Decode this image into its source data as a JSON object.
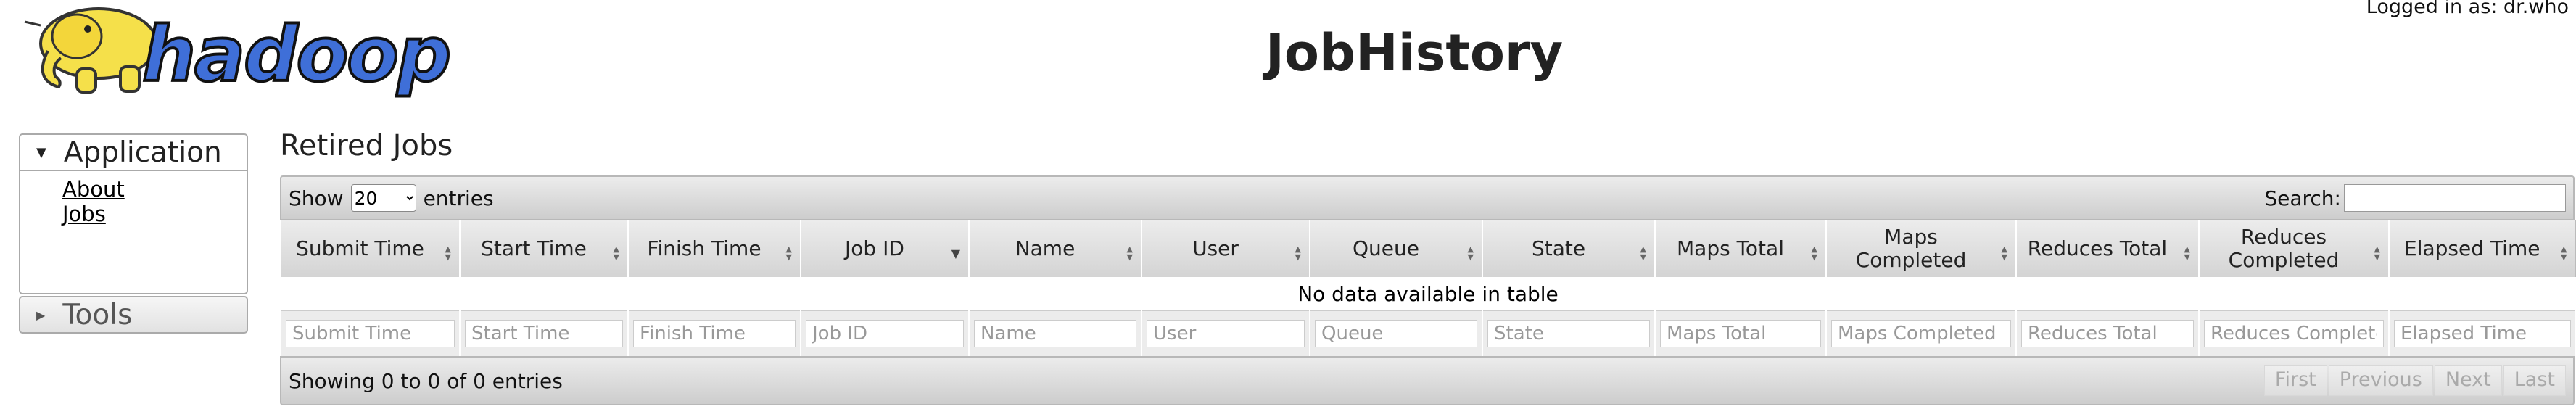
{
  "header": {
    "logo_text": "hadoop",
    "title": "JobHistory",
    "user_info": "Logged in as: dr.who"
  },
  "nav": {
    "application": {
      "label": "Application",
      "links": [
        {
          "label": "About"
        },
        {
          "label": "Jobs"
        }
      ]
    },
    "tools": {
      "label": "Tools"
    }
  },
  "main": {
    "section_title": "Retired Jobs",
    "toolbar": {
      "show_label": "Show",
      "entries_label": "entries",
      "page_length": "20",
      "page_length_options": [
        "20"
      ],
      "search_label": "Search:",
      "search_value": ""
    },
    "columns": [
      {
        "label": "Submit Time",
        "sort": "both"
      },
      {
        "label": "Start Time",
        "sort": "both"
      },
      {
        "label": "Finish Time",
        "sort": "both"
      },
      {
        "label": "Job ID",
        "sort": "desc"
      },
      {
        "label": "Name",
        "sort": "both"
      },
      {
        "label": "User",
        "sort": "both"
      },
      {
        "label": "Queue",
        "sort": "both"
      },
      {
        "label": "State",
        "sort": "both"
      },
      {
        "label": "Maps Total",
        "sort": "both"
      },
      {
        "label": "Maps Completed",
        "sort": "both"
      },
      {
        "label": "Reduces Total",
        "sort": "both"
      },
      {
        "label": "Reduces Completed",
        "sort": "both"
      },
      {
        "label": "Elapsed Time",
        "sort": "both"
      }
    ],
    "empty_message": "No data available in table",
    "filters": [
      "Submit Time",
      "Start Time",
      "Finish Time",
      "Job ID",
      "Name",
      "User",
      "Queue",
      "State",
      "Maps Total",
      "Maps Completed",
      "Reduces Total",
      "Reduces Completed",
      "Elapsed Time"
    ],
    "info": "Showing 0 to 0 of 0 entries",
    "pagination": [
      "First",
      "Previous",
      "Next",
      "Last"
    ]
  },
  "colors": {
    "bar_light": "#ececec",
    "bar_dark": "#cdcdcd",
    "border": "#b8b8b8",
    "disabled_text": "#aaaaaa"
  }
}
